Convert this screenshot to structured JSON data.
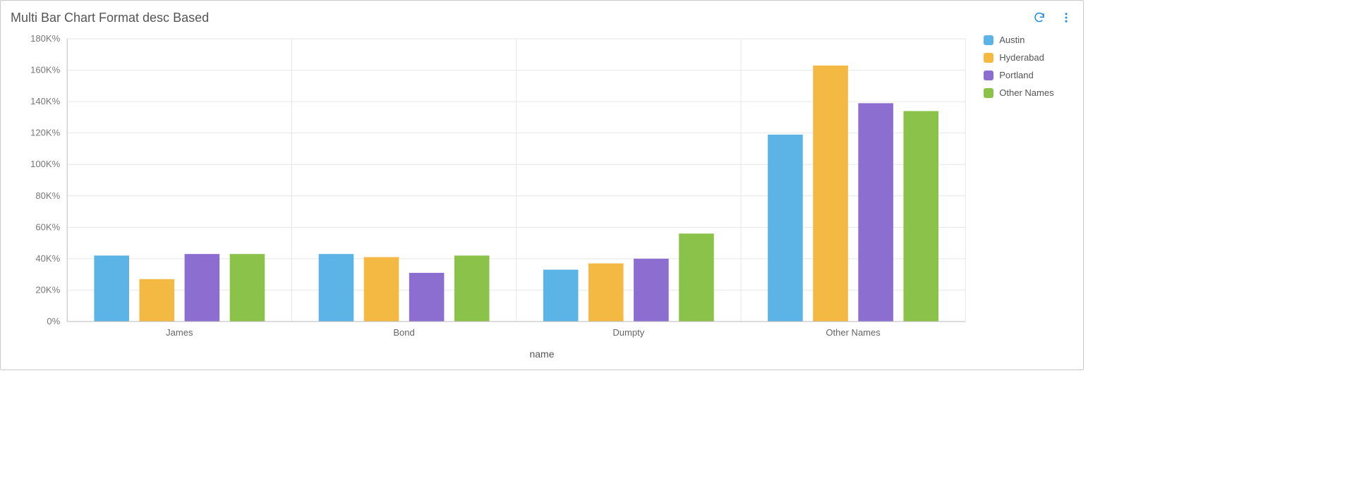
{
  "panel": {
    "title": "Multi Bar Chart Format desc Based",
    "actions": {
      "refresh": "refresh",
      "menu": "more"
    }
  },
  "chart_data": {
    "type": "bar",
    "title": "",
    "xlabel": "name",
    "ylabel": "",
    "y_ticks": [
      0,
      20,
      40,
      60,
      80,
      100,
      120,
      140,
      160,
      180
    ],
    "y_tick_labels": [
      "0%",
      "20K%",
      "40K%",
      "60K%",
      "80K%",
      "100K%",
      "120K%",
      "140K%",
      "160K%",
      "180K%"
    ],
    "ylim": [
      0,
      180
    ],
    "categories": [
      "James",
      "Bond",
      "Dumpty",
      "Other Names"
    ],
    "series": [
      {
        "name": "Austin",
        "color": "#5cb3e6",
        "values": [
          42,
          43,
          33,
          119
        ]
      },
      {
        "name": "Hyderabad",
        "color": "#f4b942",
        "values": [
          27,
          41,
          37,
          163
        ]
      },
      {
        "name": "Portland",
        "color": "#8c6dd0",
        "values": [
          43,
          31,
          40,
          139
        ]
      },
      {
        "name": "Other Names",
        "color": "#8bc34a",
        "values": [
          43,
          42,
          56,
          134
        ]
      }
    ],
    "legend_position": "right"
  }
}
